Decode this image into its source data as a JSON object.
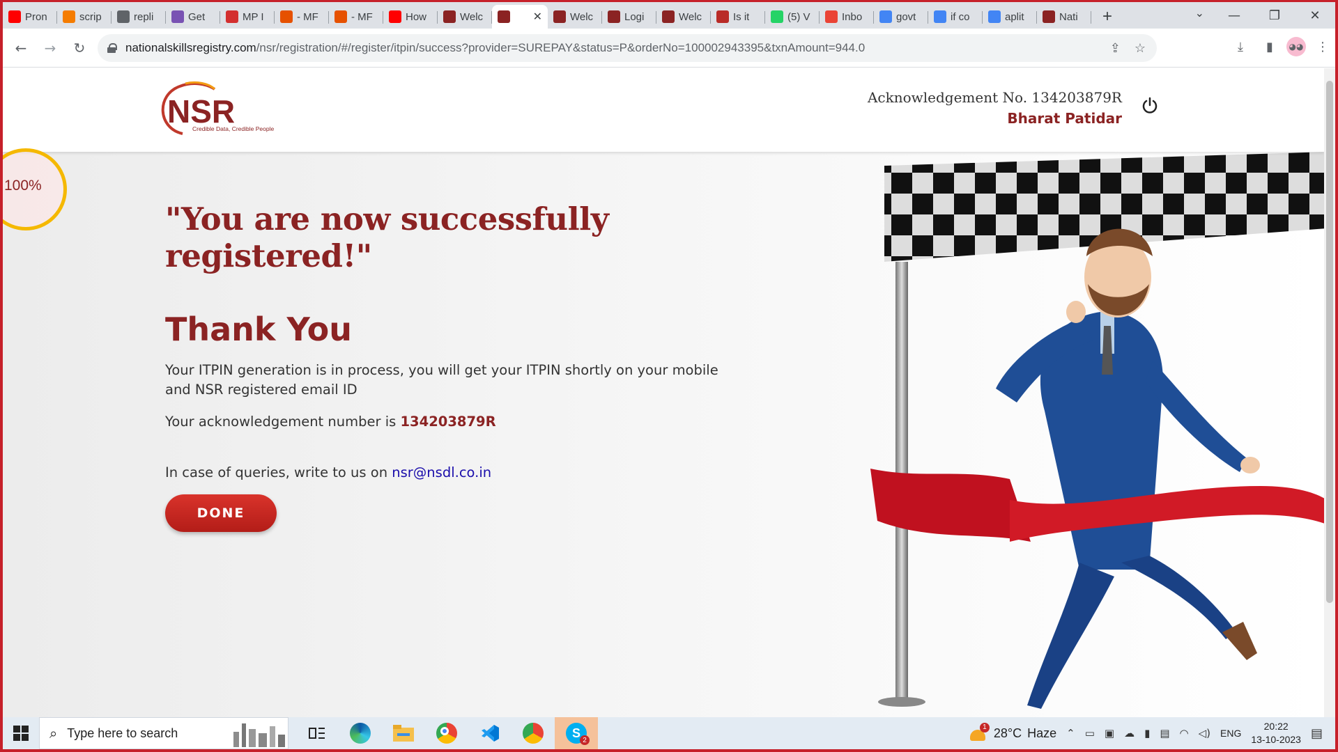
{
  "browser": {
    "tabs": [
      {
        "title": "Pron",
        "icon": "youtube-icon",
        "color": "#ff0000"
      },
      {
        "title": "scrip",
        "icon": "scripts-icon",
        "color": "#f57c00"
      },
      {
        "title": "repli",
        "icon": "globe-icon",
        "color": "#5f6368"
      },
      {
        "title": "Get",
        "icon": "bootstrap-icon",
        "color": "#7952b3"
      },
      {
        "title": "MP I",
        "icon": "s-logo-icon",
        "color": "#d32f2f"
      },
      {
        "title": "- MF",
        "icon": "mp-online-icon",
        "color": "#e65100"
      },
      {
        "title": "- MF",
        "icon": "mp-online-icon",
        "color": "#e65100"
      },
      {
        "title": "How",
        "icon": "youtube-icon",
        "color": "#ff0000"
      },
      {
        "title": "Welc",
        "icon": "nsr-icon",
        "color": "#8b2323"
      },
      {
        "title": "",
        "icon": "nsr-icon",
        "color": "#8b2323",
        "active": true
      },
      {
        "title": "Welc",
        "icon": "nsr-icon",
        "color": "#8b2323"
      },
      {
        "title": "Logi",
        "icon": "nsr-icon",
        "color": "#8b2323"
      },
      {
        "title": "Welc",
        "icon": "nsr-icon",
        "color": "#8b2323"
      },
      {
        "title": "Is it",
        "icon": "quora-icon",
        "color": "#b92b27"
      },
      {
        "title": "(5) V",
        "icon": "whatsapp-icon",
        "color": "#25d366"
      },
      {
        "title": "Inbo",
        "icon": "gmail-icon",
        "color": "#ea4335"
      },
      {
        "title": "govt",
        "icon": "google-icon",
        "color": "#4285f4"
      },
      {
        "title": "if co",
        "icon": "google-icon",
        "color": "#4285f4"
      },
      {
        "title": "aplit",
        "icon": "google-icon",
        "color": "#4285f4"
      },
      {
        "title": "Nati",
        "icon": "nsr-icon",
        "color": "#8b2323"
      }
    ],
    "url_host": "nationalskillsregistry.com",
    "url_path": "/nsr/registration/#/register/itpin/success?provider=SUREPAY&status=P&orderNo=100002943395&txnAmount=944.0"
  },
  "header": {
    "logo_text": "NSR",
    "logo_tagline": "Credible Data, Credible People",
    "ack_line": "Acknowledgement No. 134203879R",
    "user_name": "Bharat Patidar"
  },
  "progress": {
    "value": 1.0,
    "label": "100%"
  },
  "main": {
    "success_title": "\"You are now successfully registered!\"",
    "thanks": "Thank You",
    "itpin_message": "Your ITPIN generation is in process, you will get your ITPIN shortly on your mobile and NSR registered email ID",
    "ack_prefix": "Your acknowledgement number is ",
    "ack_number": "134203879R",
    "query_prefix": "In case of queries, write to us on ",
    "email": "nsr@nsdl.co.in",
    "done_label": "DONE"
  },
  "taskbar": {
    "search_placeholder": "Type here to search",
    "weather_temp": "28°C",
    "weather_desc": "Haze",
    "weather_badge": "1",
    "language": "ENG",
    "time": "20:22",
    "date": "13-10-2023",
    "skype_badge": "2"
  },
  "colors": {
    "brand": "#8b2323",
    "button": "#c62828",
    "progress_ring": "#f5b800",
    "frame_border": "#c6202a"
  }
}
